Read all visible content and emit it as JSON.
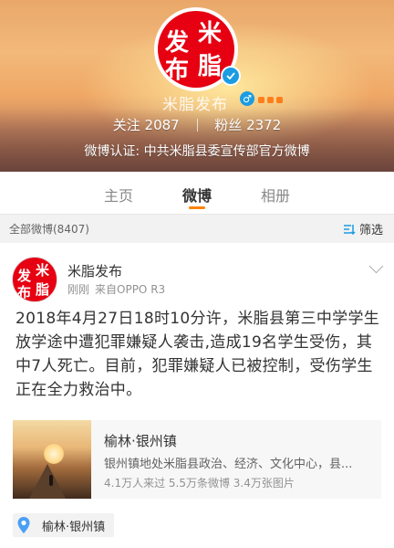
{
  "profile": {
    "name": "米脂发布",
    "avatar_text": [
      "发",
      "米",
      "布",
      "脂"
    ],
    "following_label": "关注",
    "following_count": "2087",
    "followers_label": "粉丝",
    "followers_count": "2372",
    "verify_text": "微博认证: 中共米脂县委宣传部官方微博",
    "gender_symbol": "♂"
  },
  "tabs": [
    {
      "label": "主页",
      "active": false
    },
    {
      "label": "微博",
      "active": true
    },
    {
      "label": "相册",
      "active": false
    }
  ],
  "filter_bar": {
    "count_text": "全部微博(8407)",
    "filter_label": "筛选"
  },
  "post": {
    "author": "米脂发布",
    "time": "刚刚",
    "source": "来自OPPO R3",
    "text": "2018年4月27日18时10分许，米脂县第三中学学生放学途中遭犯罪嫌疑人袭击,造成19名学生受伤，其中7人死亡。目前，犯罪嫌疑人已被控制，受伤学生正在全力救治中。",
    "location_card": {
      "title": "榆林·银州镇",
      "description": "银州镇地处米脂县政治、经济、文化中心，县...",
      "stats": "4.1万人来过  5.5万条微博  3.4万张图片"
    },
    "location_tag": "榆林·银州镇"
  },
  "colors": {
    "accent": "#ff8200",
    "seal_red": "#e60012",
    "verify_blue": "#1b9ce3",
    "link_blue": "#1b9ce3"
  }
}
